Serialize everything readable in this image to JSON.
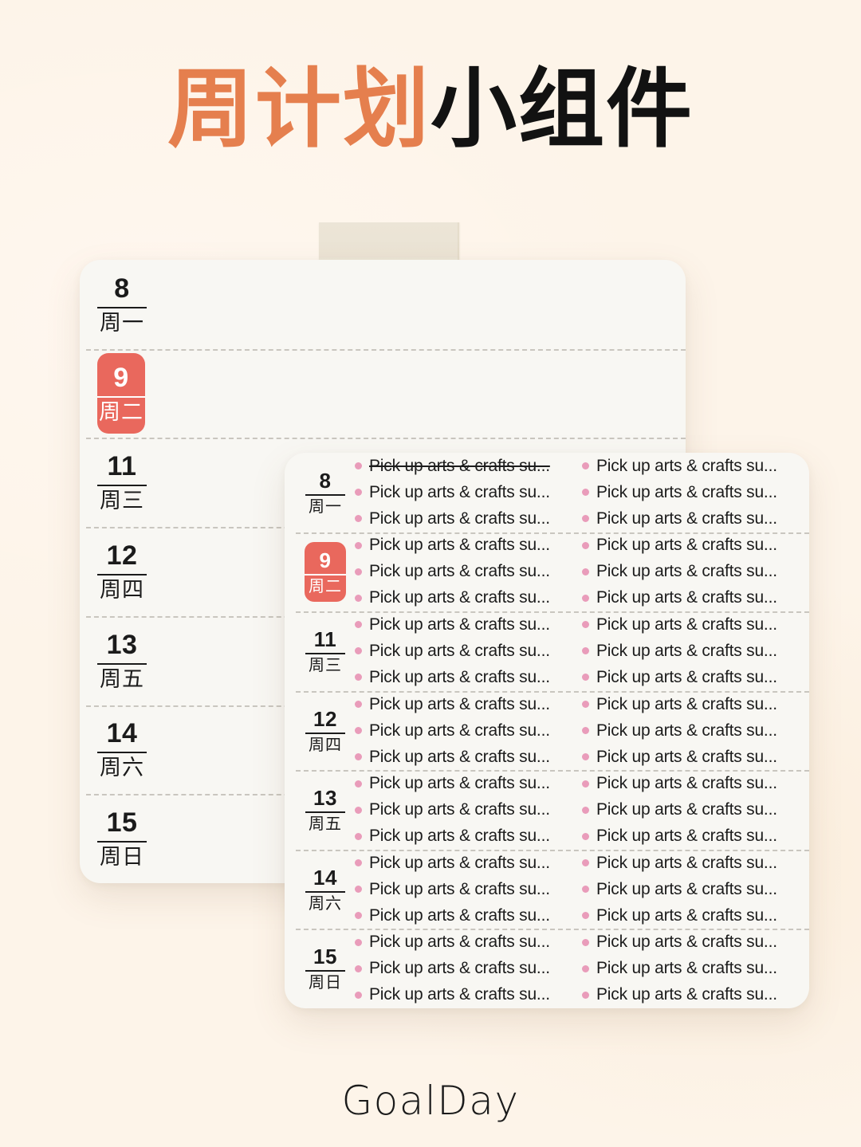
{
  "title": {
    "accent_text": "周计划",
    "dark_text": "小组件"
  },
  "brand": "GoalDay",
  "colors": {
    "background": "#fdf4e9",
    "card": "#f8f7f3",
    "accent_orange": "#e57f4e",
    "today_badge": "#e9685d",
    "bullet_pink": "#e99cba",
    "tape": "#ece5d6",
    "text": "#1b1b1b",
    "divider": "#c9c6bf"
  },
  "back_card": {
    "rows": [
      {
        "num": "8",
        "weekday": "周一",
        "today": false
      },
      {
        "num": "9",
        "weekday": "周二",
        "today": true
      },
      {
        "num": "11",
        "weekday": "周三",
        "today": false
      },
      {
        "num": "12",
        "weekday": "周四",
        "today": false
      },
      {
        "num": "13",
        "weekday": "周五",
        "today": false
      },
      {
        "num": "14",
        "weekday": "周六",
        "today": false
      },
      {
        "num": "15",
        "weekday": "周日",
        "today": false
      }
    ]
  },
  "front_card": {
    "task_label": "Pick up arts & crafts su...",
    "rows": [
      {
        "num": "8",
        "weekday": "周一",
        "today": false,
        "left_tasks": [
          {
            "text": "Pick up arts & crafts su...",
            "done": true
          },
          {
            "text": "Pick up arts & crafts su...",
            "done": false
          },
          {
            "text": "Pick up arts & crafts su...",
            "done": false
          }
        ],
        "right_tasks": [
          {
            "text": "Pick up arts & crafts su...",
            "done": false
          },
          {
            "text": "Pick up arts & crafts su...",
            "done": false
          },
          {
            "text": "Pick up arts & crafts su...",
            "done": false
          }
        ]
      },
      {
        "num": "9",
        "weekday": "周二",
        "today": true,
        "left_tasks": [
          {
            "text": "Pick up arts & crafts su...",
            "done": false
          },
          {
            "text": "Pick up arts & crafts su...",
            "done": false
          },
          {
            "text": "Pick up arts & crafts su...",
            "done": false
          }
        ],
        "right_tasks": [
          {
            "text": "Pick up arts & crafts su...",
            "done": false
          },
          {
            "text": "Pick up arts & crafts su...",
            "done": false
          },
          {
            "text": "Pick up arts & crafts su...",
            "done": false
          }
        ]
      },
      {
        "num": "11",
        "weekday": "周三",
        "today": false,
        "left_tasks": [
          {
            "text": "Pick up arts & crafts su...",
            "done": false
          },
          {
            "text": "Pick up arts & crafts su...",
            "done": false
          },
          {
            "text": "Pick up arts & crafts su...",
            "done": false
          }
        ],
        "right_tasks": [
          {
            "text": "Pick up arts & crafts su...",
            "done": false
          },
          {
            "text": "Pick up arts & crafts su...",
            "done": false
          },
          {
            "text": "Pick up arts & crafts su...",
            "done": false
          }
        ]
      },
      {
        "num": "12",
        "weekday": "周四",
        "today": false,
        "left_tasks": [
          {
            "text": "Pick up arts & crafts su...",
            "done": false
          },
          {
            "text": "Pick up arts & crafts su...",
            "done": false
          },
          {
            "text": "Pick up arts & crafts su...",
            "done": false
          }
        ],
        "right_tasks": [
          {
            "text": "Pick up arts & crafts su...",
            "done": false
          },
          {
            "text": "Pick up arts & crafts su...",
            "done": false
          },
          {
            "text": "Pick up arts & crafts su...",
            "done": false
          }
        ]
      },
      {
        "num": "13",
        "weekday": "周五",
        "today": false,
        "left_tasks": [
          {
            "text": "Pick up arts & crafts su...",
            "done": false
          },
          {
            "text": "Pick up arts & crafts su...",
            "done": false
          },
          {
            "text": "Pick up arts & crafts su...",
            "done": false
          }
        ],
        "right_tasks": [
          {
            "text": "Pick up arts & crafts su...",
            "done": false
          },
          {
            "text": "Pick up arts & crafts su...",
            "done": false
          },
          {
            "text": "Pick up arts & crafts su...",
            "done": false
          }
        ]
      },
      {
        "num": "14",
        "weekday": "周六",
        "today": false,
        "left_tasks": [
          {
            "text": "Pick up arts & crafts su...",
            "done": false
          },
          {
            "text": "Pick up arts & crafts su...",
            "done": false
          },
          {
            "text": "Pick up arts & crafts su...",
            "done": false
          }
        ],
        "right_tasks": [
          {
            "text": "Pick up arts & crafts su...",
            "done": false
          },
          {
            "text": "Pick up arts & crafts su...",
            "done": false
          },
          {
            "text": "Pick up arts & crafts su...",
            "done": false
          }
        ]
      },
      {
        "num": "15",
        "weekday": "周日",
        "today": false,
        "left_tasks": [
          {
            "text": "Pick up arts & crafts su...",
            "done": false
          },
          {
            "text": "Pick up arts & crafts su...",
            "done": false
          },
          {
            "text": "Pick up arts & crafts su...",
            "done": false
          }
        ],
        "right_tasks": [
          {
            "text": "Pick up arts & crafts su...",
            "done": false
          },
          {
            "text": "Pick up arts & crafts su...",
            "done": false
          },
          {
            "text": "Pick up arts & crafts su...",
            "done": false
          }
        ]
      }
    ]
  }
}
